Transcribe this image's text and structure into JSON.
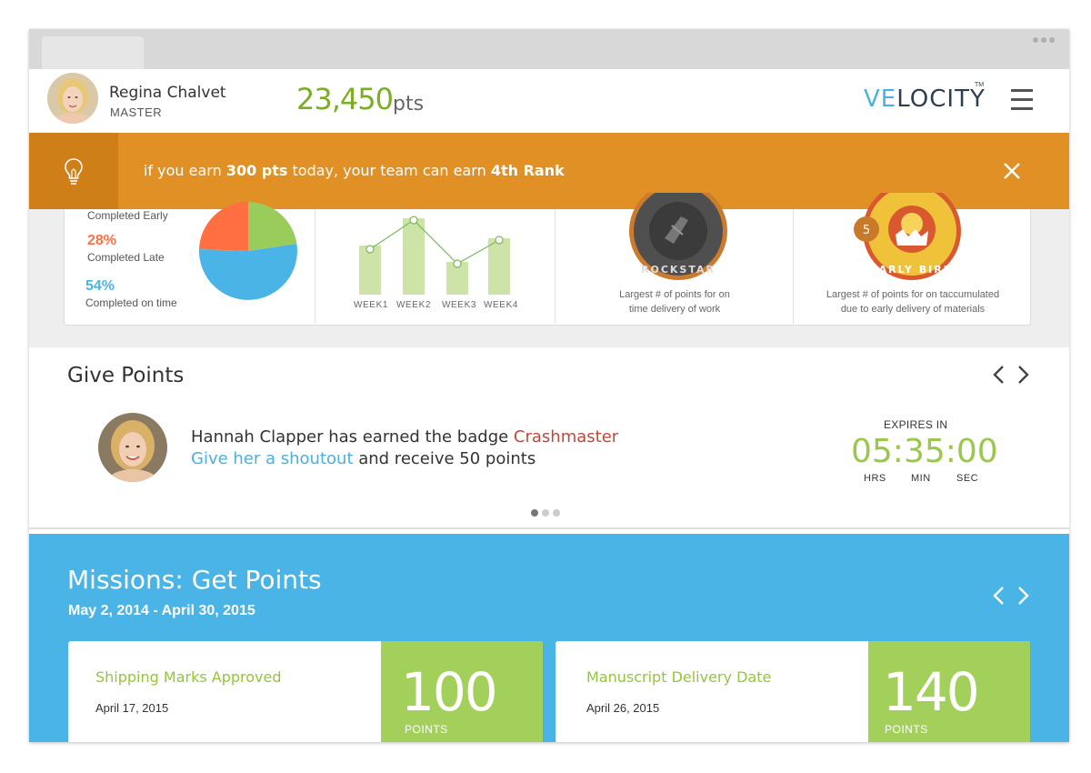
{
  "user": {
    "name": "Regina Chalvet",
    "rank": "MASTER",
    "points": "23,450",
    "points_unit": "pts"
  },
  "brand": {
    "logo_accent": "VE",
    "logo_rest": "LOCITY",
    "tm": "TM"
  },
  "notice": {
    "pre": "if you earn ",
    "bold1": "300 pts",
    "mid": " today, your team can earn ",
    "bold2": "4th Rank"
  },
  "completion": {
    "items": [
      {
        "label": "Completed Early",
        "pct": null,
        "color": "#99cc5a"
      },
      {
        "label": "Completed Late",
        "pct": "28%",
        "color": "#ff6f41"
      },
      {
        "label": "Completed on time",
        "pct": "54%",
        "color": "#4bb4e6"
      }
    ]
  },
  "weekly": {
    "weeks": [
      "WEEK1",
      "WEEK2",
      "WEEK3",
      "WEEK4"
    ]
  },
  "badges": [
    {
      "caption1": "Largest # of points for on",
      "caption2": "time delivery of work",
      "ring_text": "ROCKSTAR"
    },
    {
      "caption1": "Largest # of points for on taccumulated",
      "caption2": "due to early delivery of  materials",
      "ring_text": "EARLY BIRD",
      "count": "5"
    }
  ],
  "give_points": {
    "title": "Give Points",
    "earner": "Hannah Clapper",
    "earned_text": " has earned the badge ",
    "badge_name": "Crashmaster",
    "shoutout_link": "Give her a shoutout",
    "reward_text": " and receive 50 points",
    "expires_label": "EXPIRES IN",
    "timer": "05:35:00",
    "units": [
      "HRS",
      "MIN",
      "SEC"
    ]
  },
  "missions": {
    "title": "Missions: Get Points",
    "range": "May 2, 2014 - April 30, 2015",
    "cards": [
      {
        "name": "Shipping Marks Approved",
        "date": "April 17, 2015",
        "points": "100",
        "points_label": "POINTS"
      },
      {
        "name": "Manuscript Delivery Date",
        "date": "April 26, 2015",
        "points": "140",
        "points_label": "POINTS"
      }
    ]
  },
  "colors": {
    "accent_green": "#7bae24",
    "notice_orange": "#e09025",
    "missions_blue": "#4bb4e6",
    "badge_red": "#c0483a"
  },
  "icons": {
    "notice": "lightbulb-icon",
    "close": "close-icon",
    "menu": "hamburger-menu-icon"
  }
}
